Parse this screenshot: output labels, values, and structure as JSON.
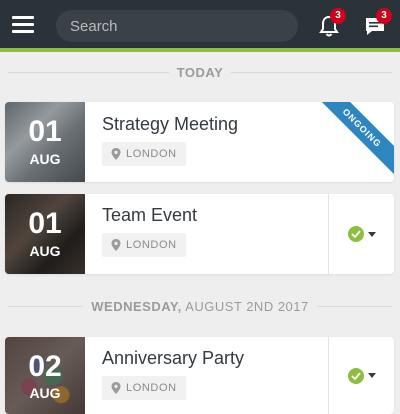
{
  "header": {
    "search_placeholder": "Search",
    "notifications_count": "3",
    "messages_count": "3"
  },
  "sections": {
    "today": "TODAY",
    "wednesday_weekday": "WEDNESDAY,",
    "wednesday_rest": "AUGUST 2ND 2017"
  },
  "events": [
    {
      "day": "01",
      "month": "AUG",
      "title": "Strategy Meeting",
      "location": "LONDON",
      "ribbon": "ONGOING"
    },
    {
      "day": "01",
      "month": "AUG",
      "title": "Team Event",
      "location": "LONDON"
    },
    {
      "day": "02",
      "month": "AUG",
      "title": "Anniversary Party",
      "location": "LONDON"
    }
  ],
  "colors": {
    "topbar": "#2b333a",
    "accent": "#8cbf3f",
    "badge": "#d0021b",
    "ribbon": "#2e86c1"
  }
}
